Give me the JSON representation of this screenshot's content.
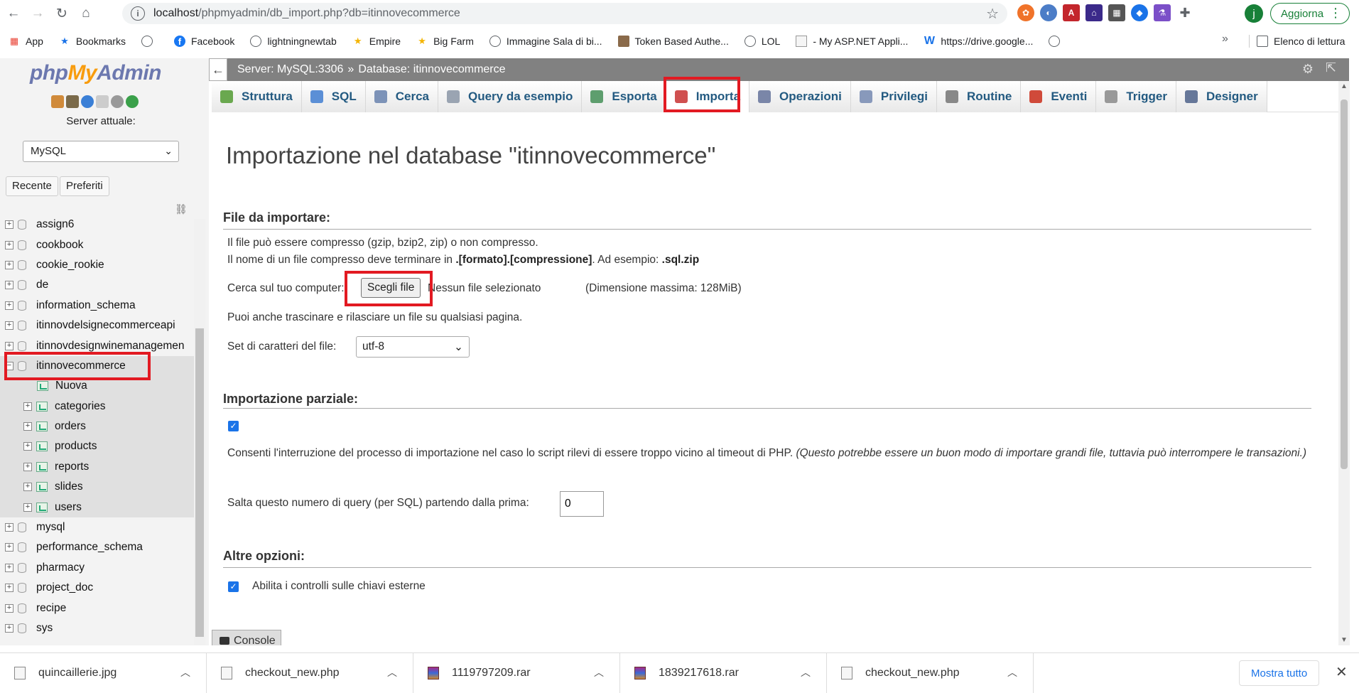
{
  "browser": {
    "url_host": "localhost",
    "url_path": "/phpmyadmin/db_import.php?db=itinnovecommerce",
    "avatar_letter": "j",
    "update_label": "Aggiorna"
  },
  "bookmarks": {
    "items": [
      "App",
      "Bookmarks",
      "Facebook",
      "lightningnewtab",
      "Empire",
      "Big Farm",
      "Immagine Sala di bi...",
      "Token Based Authe...",
      "LOL",
      "- My ASP.NET Appli...",
      "https://drive.google..."
    ],
    "more": "»",
    "reading_list": "Elenco di lettura"
  },
  "sidebar": {
    "logo_php": "php",
    "logo_my": "My",
    "logo_admin": "Admin",
    "server_label": "Server attuale:",
    "server_value": "MySQL",
    "recent_label": "Recente",
    "favorites_label": "Preferiti",
    "databases": [
      {
        "name": "assign6"
      },
      {
        "name": "cookbook"
      },
      {
        "name": "cookie_rookie"
      },
      {
        "name": "de"
      },
      {
        "name": "information_schema"
      },
      {
        "name": "itinnovdelsignecommerceapi"
      },
      {
        "name": "itinnovdesignwinemanagemen"
      },
      {
        "name": "itinnovecommerce"
      }
    ],
    "active_children": {
      "new_label": "Nuova",
      "tables": [
        "categories",
        "orders",
        "products",
        "reports",
        "slides",
        "users"
      ]
    },
    "databases_after": [
      "mysql",
      "performance_schema",
      "pharmacy",
      "project_doc",
      "recipe",
      "sys"
    ]
  },
  "topbar": {
    "server": "Server: MySQL:3306",
    "separator": "»",
    "database": "Database: itinnovecommerce"
  },
  "tabs": [
    {
      "label": "Struttura",
      "color": "#6aa84f"
    },
    {
      "label": "SQL",
      "color": "#5b8fd6"
    },
    {
      "label": "Cerca",
      "color": "#7d93b8"
    },
    {
      "label": "Query da esempio",
      "color": "#9aa4b2"
    },
    {
      "label": "Esporta",
      "color": "#5e9e6e"
    },
    {
      "label": "Importa",
      "color": "#d05050"
    },
    {
      "label": "Operazioni",
      "color": "#7a86a8"
    },
    {
      "label": "Privilegi",
      "color": "#8899bb"
    },
    {
      "label": "Routine",
      "color": "#888888"
    },
    {
      "label": "Eventi",
      "color": "#d04a3a"
    },
    {
      "label": "Trigger",
      "color": "#999999"
    },
    {
      "label": "Designer",
      "color": "#667799"
    }
  ],
  "main": {
    "title": "Importazione nel database \"itinnovecommerce\"",
    "file_section": "File da importare:",
    "compress_line1": "Il file può essere compresso (gzip, bzip2, zip) o non compresso.",
    "compress_line2_a": "Il nome di un file compresso deve terminare in ",
    "compress_line2_b": ".[formato].[compressione]",
    "compress_line2_c": ". Ad esempio: ",
    "compress_line2_d": ".sql.zip",
    "browse_label": "Cerca sul tuo computer:",
    "choose_file": "Scegli file",
    "no_file": "Nessun file selezionato",
    "max_size": "(Dimensione massima: 128MiB)",
    "drag_hint": "Puoi anche trascinare e rilasciare un file su qualsiasi pagina.",
    "charset_label": "Set di caratteri del file:",
    "charset_value": "utf-8",
    "partial_section": "Importazione parziale:",
    "interrupt_text": "Consenti l'interruzione del processo di importazione nel caso lo script rilevi di essere troppo vicino al timeout di PHP.",
    "interrupt_note_1": "(Questo potrebbe essere un buon modo di importare grandi file, tuttavia può interrompere le",
    "interrupt_note_2": "transazioni.)",
    "skip_label": "Salta questo numero di query (per SQL) partendo dalla prima:",
    "skip_value": "0",
    "other_section": "Altre opzioni:",
    "fk_label": "Abilita i controlli sulle chiavi esterne",
    "console_label": "Console"
  },
  "downloads": {
    "items": [
      "quincaillerie.jpg",
      "checkout_new.php",
      "1119797209.rar",
      "1839217618.rar",
      "checkout_new.php"
    ],
    "show_all": "Mostra tutto"
  }
}
